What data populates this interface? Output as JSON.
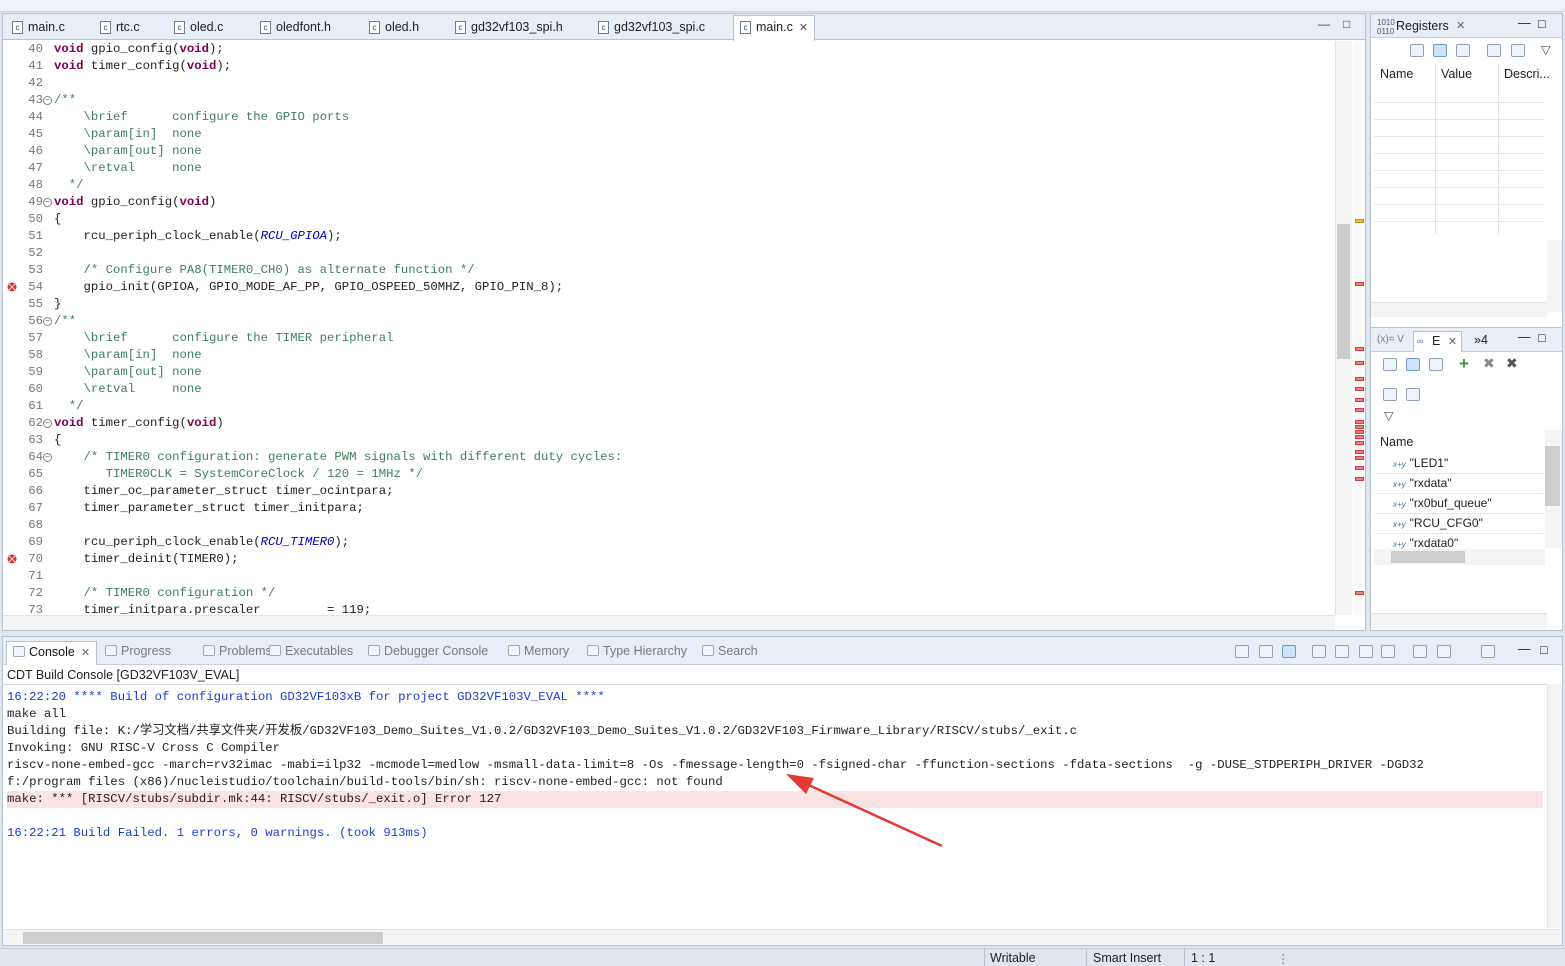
{
  "editor": {
    "tabs": [
      {
        "label": "main.c"
      },
      {
        "label": "rtc.c"
      },
      {
        "label": "oled.c"
      },
      {
        "label": "oledfont.h"
      },
      {
        "label": "oled.h"
      },
      {
        "label": "gd32vf103_spi.h"
      },
      {
        "label": "gd32vf103_spi.c"
      },
      {
        "label": "main.c",
        "active": true,
        "close": "✕"
      }
    ],
    "lines": [
      {
        "n": "40",
        "t": "void gpio_config(void);"
      },
      {
        "n": "41",
        "t": "void timer_config(void);"
      },
      {
        "n": "42",
        "t": ""
      },
      {
        "n": "43",
        "t": "/**",
        "fold": true
      },
      {
        "n": "44",
        "t": "    \\brief      configure the GPIO ports"
      },
      {
        "n": "45",
        "t": "    \\param[in]  none"
      },
      {
        "n": "46",
        "t": "    \\param[out] none"
      },
      {
        "n": "47",
        "t": "    \\retval     none"
      },
      {
        "n": "48",
        "t": "  */"
      },
      {
        "n": "49",
        "t": "void gpio_config(void)",
        "fold": true
      },
      {
        "n": "50",
        "t": "{"
      },
      {
        "n": "51",
        "t": "    rcu_periph_clock_enable(RCU_GPIOA);"
      },
      {
        "n": "52",
        "t": ""
      },
      {
        "n": "53",
        "t": "    /* Configure PA8(TIMER0_CH0) as alternate function */"
      },
      {
        "n": "54",
        "t": "    gpio_init(GPIOA, GPIO_MODE_AF_PP, GPIO_OSPEED_50MHZ, GPIO_PIN_8);",
        "bp": true
      },
      {
        "n": "55",
        "t": "}"
      },
      {
        "n": "56",
        "t": "/**",
        "fold": true
      },
      {
        "n": "57",
        "t": "    \\brief      configure the TIMER peripheral"
      },
      {
        "n": "58",
        "t": "    \\param[in]  none"
      },
      {
        "n": "59",
        "t": "    \\param[out] none"
      },
      {
        "n": "60",
        "t": "    \\retval     none"
      },
      {
        "n": "61",
        "t": "  */"
      },
      {
        "n": "62",
        "t": "void timer_config(void)",
        "fold": true
      },
      {
        "n": "63",
        "t": "{"
      },
      {
        "n": "64",
        "t": "    /* TIMER0 configuration: generate PWM signals with different duty cycles:",
        "fold": true
      },
      {
        "n": "65",
        "t": "       TIMER0CLK = SystemCoreClock / 120 = 1MHz */"
      },
      {
        "n": "66",
        "t": "    timer_oc_parameter_struct timer_ocintpara;"
      },
      {
        "n": "67",
        "t": "    timer_parameter_struct timer_initpara;"
      },
      {
        "n": "68",
        "t": ""
      },
      {
        "n": "69",
        "t": "    rcu_periph_clock_enable(RCU_TIMER0);"
      },
      {
        "n": "70",
        "t": "    timer_deinit(TIMER0);",
        "bp": true
      },
      {
        "n": "71",
        "t": ""
      },
      {
        "n": "72",
        "t": "    /* TIMER0 configuration */"
      },
      {
        "n": "73",
        "t": "    timer_initpara.prescaler         = 119;"
      }
    ]
  },
  "registers": {
    "title": "Registers",
    "close": "✕",
    "columns": [
      "Name",
      "Value",
      "Descri..."
    ]
  },
  "expressions": {
    "tab_v": "V",
    "tab_e": "E",
    "tab_more": "»4",
    "column": "Name",
    "items": [
      "\"LED1\"",
      "\"rxdata\"",
      "\"rx0buf_queue\"",
      "\"RCU_CFG0\"",
      "\"rxdata0\""
    ],
    "item_icon": "x+y"
  },
  "console": {
    "tabs": [
      {
        "label": "Console",
        "active": true
      },
      {
        "label": "Progress"
      },
      {
        "label": "Problems"
      },
      {
        "label": "Executables"
      },
      {
        "label": "Debugger Console"
      },
      {
        "label": "Memory"
      },
      {
        "label": "Type Hierarchy"
      },
      {
        "label": "Search"
      }
    ],
    "title": "CDT Build Console [GD32VF103V_EVAL]",
    "lines": [
      {
        "t": "16:22:20 **** Build of configuration GD32VF103xB for project GD32VF103V_EVAL ****",
        "style": "blue"
      },
      {
        "t": "make all",
        "style": ""
      },
      {
        "t": "Building file: K:/学习文档/共享文件夹/开发板/GD32VF103_Demo_Suites_V1.0.2/GD32VF103_Demo_Suites_V1.0.2/GD32VF103_Firmware_Library/RISCV/stubs/_exit.c",
        "style": ""
      },
      {
        "t": "Invoking: GNU RISC-V Cross C Compiler",
        "style": ""
      },
      {
        "t": "riscv-none-embed-gcc -march=rv32imac -mabi=ilp32 -mcmodel=medlow -msmall-data-limit=8 -Os -fmessage-length=0 -fsigned-char -ffunction-sections -fdata-sections  -g -DUSE_STDPERIPH_DRIVER -DGD32",
        "style": ""
      },
      {
        "t": "f:/program files (x86)/nucleistudio/toolchain/build-tools/bin/sh: riscv-none-embed-gcc: not found",
        "style": ""
      },
      {
        "t": "make: *** [RISCV/stubs/subdir.mk:44: RISCV/stubs/_exit.o] Error 127",
        "style": "err"
      },
      {
        "t": "",
        "style": ""
      },
      {
        "t": "16:22:21 Build Failed. 1 errors, 0 warnings. (took 913ms)",
        "style": "blue"
      }
    ]
  },
  "status": {
    "writable": "Writable",
    "insert": "Smart Insert",
    "position": "1 : 1"
  },
  "colors": {
    "keyword": "#7f0055",
    "comment": "#3f7f5f",
    "macro": "#0000c0",
    "console_blue": "#1a3fd0",
    "error_bg": "#fbe3e3",
    "arrow": "#e53935"
  }
}
